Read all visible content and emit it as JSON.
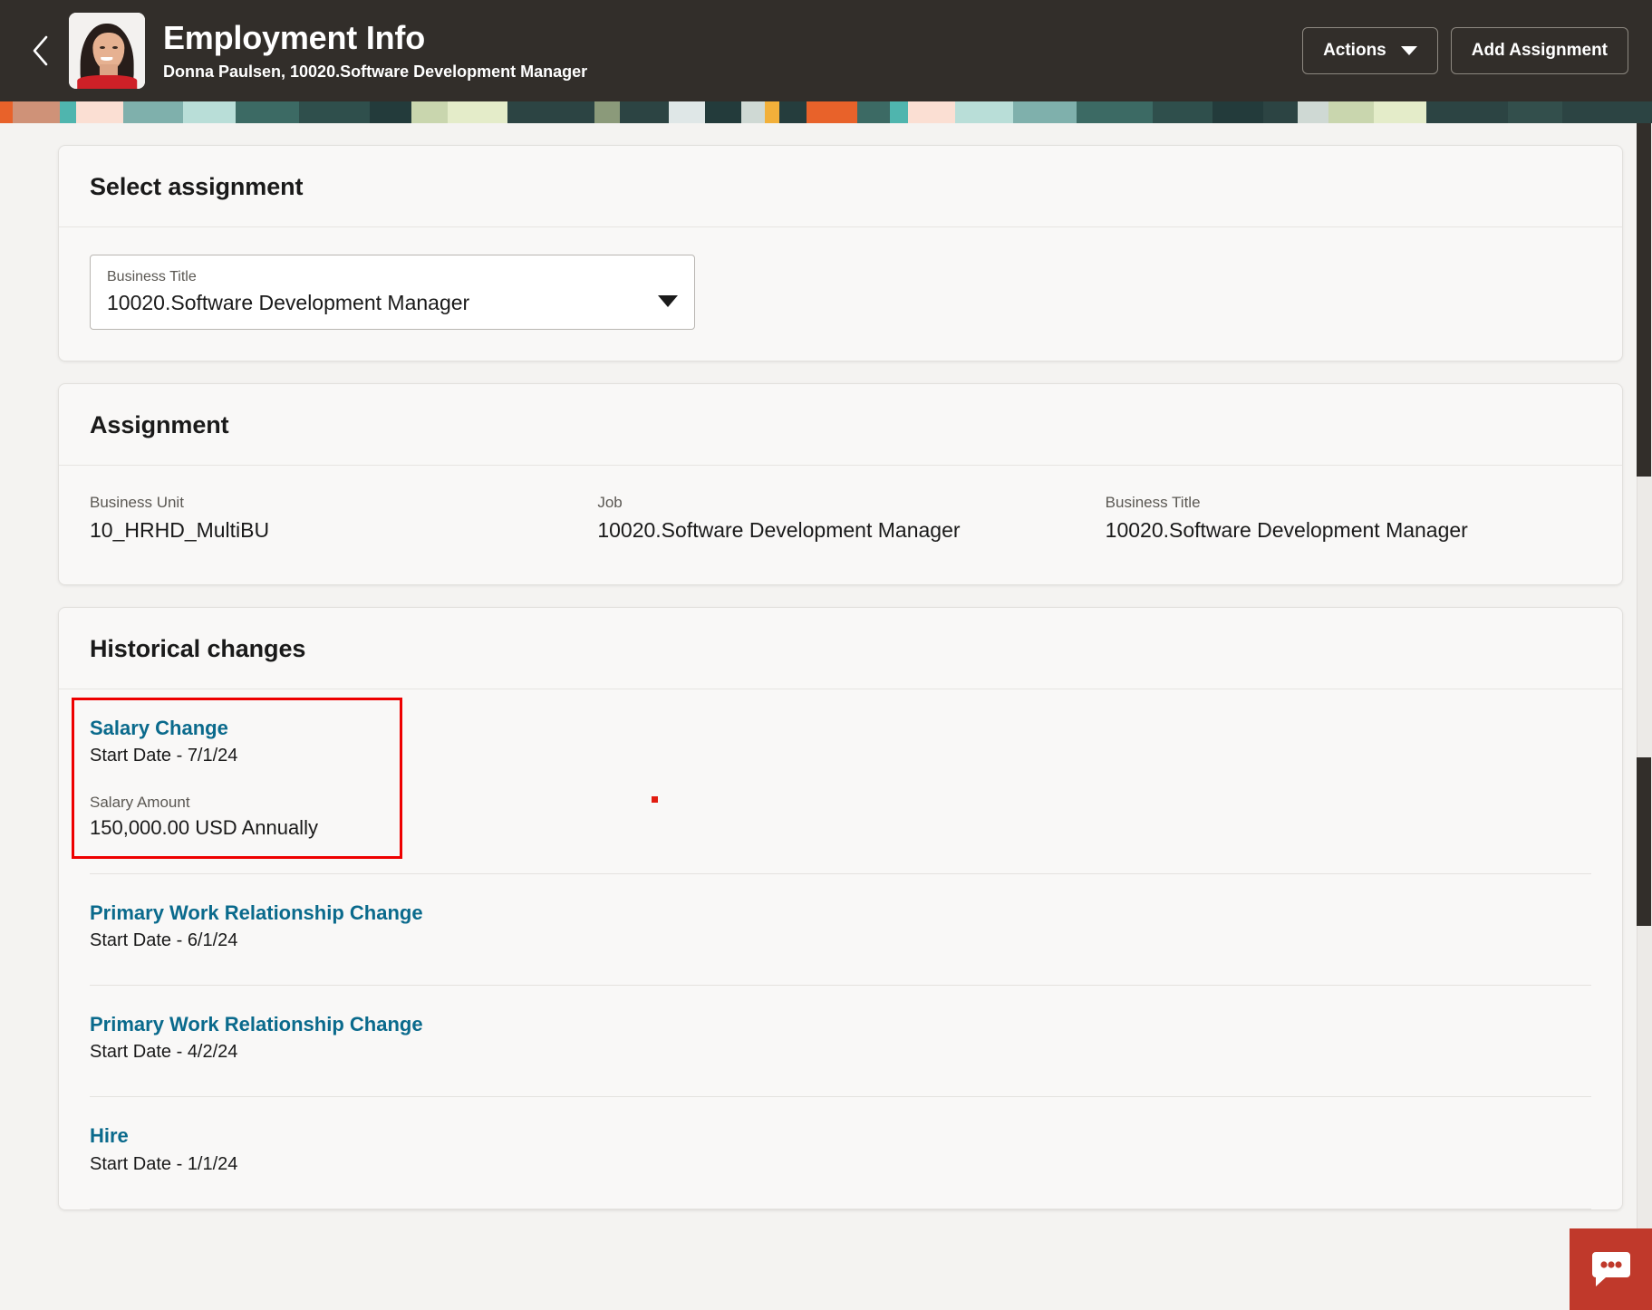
{
  "header": {
    "back_icon": "chevron-left-icon",
    "avatar_alt": "Employee photo",
    "title": "Employment Info",
    "subtitle": "Donna Paulsen, 10020.Software Development Manager",
    "actions_label": "Actions",
    "add_assignment_label": "Add Assignment",
    "background_color": "#322e2a"
  },
  "select_assignment": {
    "card_title": "Select assignment",
    "field_label": "Business Title",
    "field_value": "10020.Software Development Manager"
  },
  "assignment": {
    "card_title": "Assignment",
    "fields": [
      {
        "label": "Business Unit",
        "value": "10_HRHD_MultiBU"
      },
      {
        "label": "Job",
        "value": "10020.Software Development Manager"
      },
      {
        "label": "Business Title",
        "value": "10020.Software Development Manager"
      }
    ]
  },
  "historical_changes": {
    "card_title": "Historical changes",
    "items": [
      {
        "title": "Salary Change",
        "date": "Start Date - 7/1/24",
        "detail_label": "Salary Amount",
        "detail_value": "150,000.00 USD Annually",
        "highlighted": true
      },
      {
        "title": "Primary Work Relationship Change",
        "date": "Start Date - 6/1/24",
        "detail_label": "",
        "detail_value": "",
        "highlighted": false
      },
      {
        "title": "Primary Work Relationship Change",
        "date": "Start Date - 4/2/24",
        "detail_label": "",
        "detail_value": "",
        "highlighted": false
      },
      {
        "title": "Hire",
        "date": "Start Date - 1/1/24",
        "detail_label": "",
        "detail_value": "",
        "highlighted": false
      }
    ]
  },
  "chat_widget": {
    "icon": "chat-bubble-icon",
    "color": "#c0392b"
  },
  "colors": {
    "link": "#0a6a8c",
    "highlight": "#ee0000",
    "card_bg": "#f9f8f7",
    "page_bg": "#f4f3f1"
  }
}
